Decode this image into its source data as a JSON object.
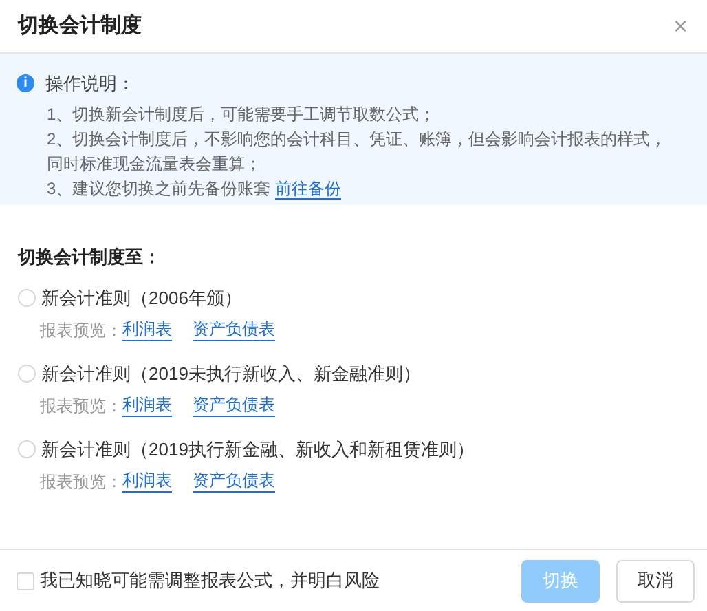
{
  "dialog": {
    "title": "切换会计制度",
    "close": "×"
  },
  "notice": {
    "icon": "i",
    "heading": "操作说明：",
    "lines": [
      "1、切换新会计制度后，可能需要手工调节取数公式；",
      "2、切换会计制度后，不影响您的会计科目、凭证、账簿，但会影响会计报表的样式，同时标准现金流量表会重算；",
      "3、建议您切换之前先备份账套"
    ],
    "link": "前往备份"
  },
  "section_title": "切换会计制度至：",
  "options": [
    {
      "label": "新会计准则（2006年颁）",
      "selected": false,
      "preview_label": "报表预览：",
      "links": [
        "利润表",
        "资产负债表"
      ]
    },
    {
      "label": "新会计准则（2019未执行新收入、新金融准则）",
      "selected": false,
      "preview_label": "报表预览：",
      "links": [
        "利润表",
        "资产负债表"
      ]
    },
    {
      "label": "新会计准则（2019执行新金融、新收入和新租赁准则）",
      "selected": false,
      "preview_label": "报表预览：",
      "links": [
        "利润表",
        "资产负债表"
      ]
    }
  ],
  "footer": {
    "acknowledge": {
      "label": "我已知晓可能需调整报表公式，并明白风险",
      "checked": false
    },
    "buttons": [
      {
        "label": "切换",
        "disabled": true
      },
      {
        "label": "取消",
        "disabled": false
      }
    ]
  }
}
